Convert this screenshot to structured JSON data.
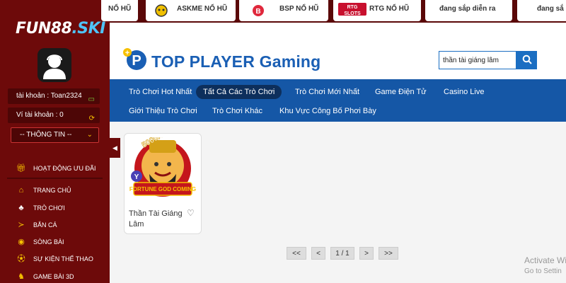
{
  "brand": {
    "logo_main": "FUN88",
    "logo_suffix": ".SKI"
  },
  "account": {
    "username_label": "tài khoản : Toan2324",
    "wallet_label": "Ví tài khoản : 0",
    "info_label": "-- THÔNG TIN --"
  },
  "menu": {
    "promo": "HOẠT ĐỘNG ƯU ĐÃI",
    "items": [
      "TRANG CHỦ",
      "TRÒ CHƠI",
      "BẮN CÁ",
      "SÒNG BÀI",
      "SỰ KIỆN THỂ THAO",
      "GAME BÀI 3D"
    ]
  },
  "providers": [
    {
      "label": "NỔ HŨ"
    },
    {
      "label": "ASKME NỔ HŨ"
    },
    {
      "label": "BSP NỔ HŨ"
    },
    {
      "label": "RTG NỔ HŨ",
      "icon_text": "RTG SLOTS"
    },
    {
      "label": "đang sắp diễn ra"
    },
    {
      "label": "đang sắ"
    }
  ],
  "header": {
    "title": "TOP PLAYER Gaming"
  },
  "search": {
    "value": "thần tài giáng lâm"
  },
  "tabs": [
    "Trò Chơi Hot Nhất",
    "Tất Cả Các Trò Chơi",
    "Trò Chơi Mới Nhất",
    "Game Điện Tử",
    "Casino Live",
    "Giới Thiệu Trò Chơi",
    "Trò Chơi Khác",
    "Khu Vực Công Bố Phơi Bày"
  ],
  "games": [
    {
      "title": "Thần Tài Giáng Lâm",
      "art_badge": "5000X",
      "art_text": "FORTUNE GOD COMING"
    }
  ],
  "pagination": {
    "first": "<<",
    "prev": "<",
    "page": "1 / 1",
    "next": ">",
    "last": ">>"
  },
  "watermark": {
    "line1": "Activate Wi",
    "line2": "Go to Settin"
  },
  "colors": {
    "sidebar": "#6d0a0a",
    "nav": "#1557a6",
    "brand_blue": "#1a5fb4",
    "active_tab": "#0d2f5c"
  }
}
